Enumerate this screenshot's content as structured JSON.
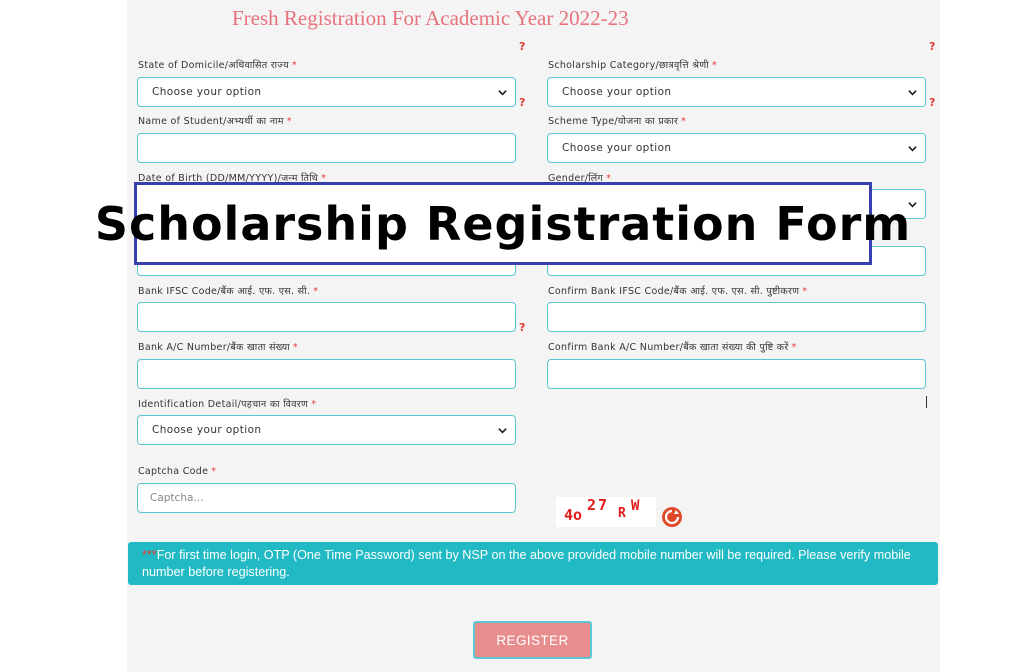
{
  "page": {
    "title": "Fresh Registration For Academic Year 2022-23",
    "overlay_title": "Scholarship Registration Form",
    "help_mark": "?",
    "required_mark": "*"
  },
  "left": {
    "domicile": {
      "label": "State of Domicile/अधिवासित राज्य",
      "value": "Choose your option"
    },
    "student_name": {
      "label": "Name of Student/अभ्यर्थी का नाम",
      "value": ""
    },
    "dob": {
      "label": "Date of Birth (DD/MM/YYYY)/जन्म तिथि",
      "value": ""
    },
    "ifsc": {
      "label": "Bank IFSC Code/बैंक आई. एफ. एस. सी.",
      "value": ""
    },
    "account": {
      "label": "Bank A/C Number/बैंक खाता संख्या",
      "value": ""
    },
    "identification": {
      "label": "Identification Detail/पहचान का विवरण",
      "value": "Choose your option"
    },
    "captcha": {
      "label": "Captcha Code",
      "placeholder": "Captcha..."
    }
  },
  "right": {
    "category": {
      "label": "Scholarship Category/छात्रवृत्ति श्रेणी",
      "value": "Choose your option"
    },
    "scheme": {
      "label": "Scheme Type/योजना का प्रकार",
      "value": "Choose your option"
    },
    "gender": {
      "label": "Gender/लिंग",
      "value": ""
    },
    "confirm_ifsc": {
      "label": "Confirm Bank IFSC Code/बैंक आई. एफ. एस. सी. पुष्टीकरण",
      "value": ""
    },
    "confirm_account": {
      "label": "Confirm Bank A/C Number/बैंक खाता संख्या की पुष्टि करें",
      "value": ""
    }
  },
  "captcha_image": {
    "c1": "4o",
    "c2": "27",
    "c3": "R",
    "c4": "W"
  },
  "notice": {
    "stars": "***",
    "text": "For first time login, OTP (One Time Password) sent by NSP on the above provided mobile number will be required. Please verify mobile number before registering."
  },
  "register_label": "REGISTER",
  "colors": {
    "title": "#e8727c",
    "accent": "#5bc6d0",
    "notice_bg": "#21bac4",
    "button": "#e88d8d",
    "required": "#e53935",
    "overlay_border": "#3a3fb0"
  },
  "icons": {
    "dropdown": "chevron-down-icon",
    "refresh": "refresh-icon"
  }
}
